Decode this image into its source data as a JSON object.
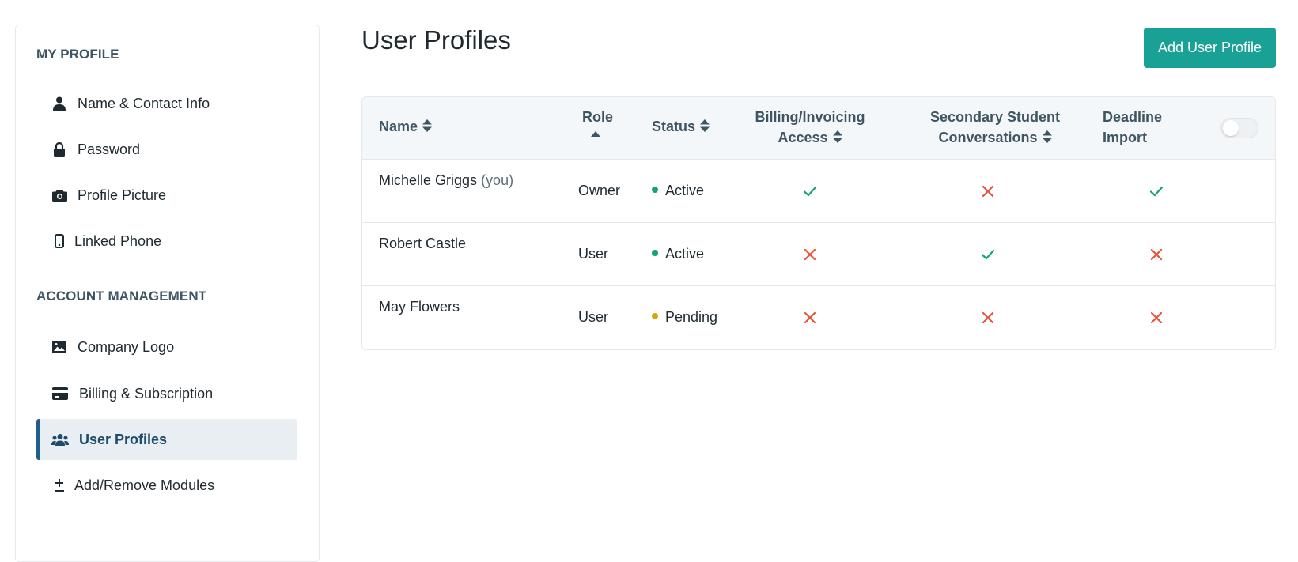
{
  "sidebar": {
    "sections": [
      {
        "title": "MY PROFILE"
      },
      {
        "title": "ACCOUNT MANAGEMENT"
      }
    ],
    "items": [
      {
        "label": "Name & Contact Info",
        "icon": "person-icon"
      },
      {
        "label": "Password",
        "icon": "lock-icon"
      },
      {
        "label": "Profile Picture",
        "icon": "camera-icon"
      },
      {
        "label": "Linked Phone",
        "icon": "phone-icon"
      },
      {
        "label": "Company Logo",
        "icon": "image-icon"
      },
      {
        "label": "Billing & Subscription",
        "icon": "credit-card-icon"
      },
      {
        "label": "User Profiles",
        "icon": "users-icon",
        "active": true
      },
      {
        "label": "Add/Remove Modules",
        "icon": "plus-minus-icon"
      }
    ]
  },
  "header": {
    "title": "User Profiles",
    "add_button": "Add User Profile"
  },
  "table": {
    "columns": {
      "name": "Name",
      "role": "Role",
      "status": "Status",
      "billing_line1": "Billing/Invoicing",
      "billing_line2": "Access",
      "secondary_line1": "Secondary Student",
      "secondary_line2": "Conversations",
      "deadline_line1": "Deadline",
      "deadline_line2": "Import"
    },
    "rows": [
      {
        "name": "Michelle Griggs",
        "suffix": "(you)",
        "role": "Owner",
        "status": "Active",
        "billing": true,
        "secondary": false,
        "deadline": true
      },
      {
        "name": "Robert Castle",
        "suffix": "",
        "role": "User",
        "status": "Active",
        "billing": false,
        "secondary": true,
        "deadline": false
      },
      {
        "name": "May Flowers",
        "suffix": "",
        "role": "User",
        "status": "Pending",
        "billing": false,
        "secondary": false,
        "deadline": false
      }
    ]
  },
  "colors": {
    "accent": "#1aa196",
    "active_dot": "#12a56f",
    "pending_dot": "#d4a70e",
    "check": "#12a56f",
    "cross": "#e8523a",
    "nav_active_border": "#1e5f8e"
  }
}
